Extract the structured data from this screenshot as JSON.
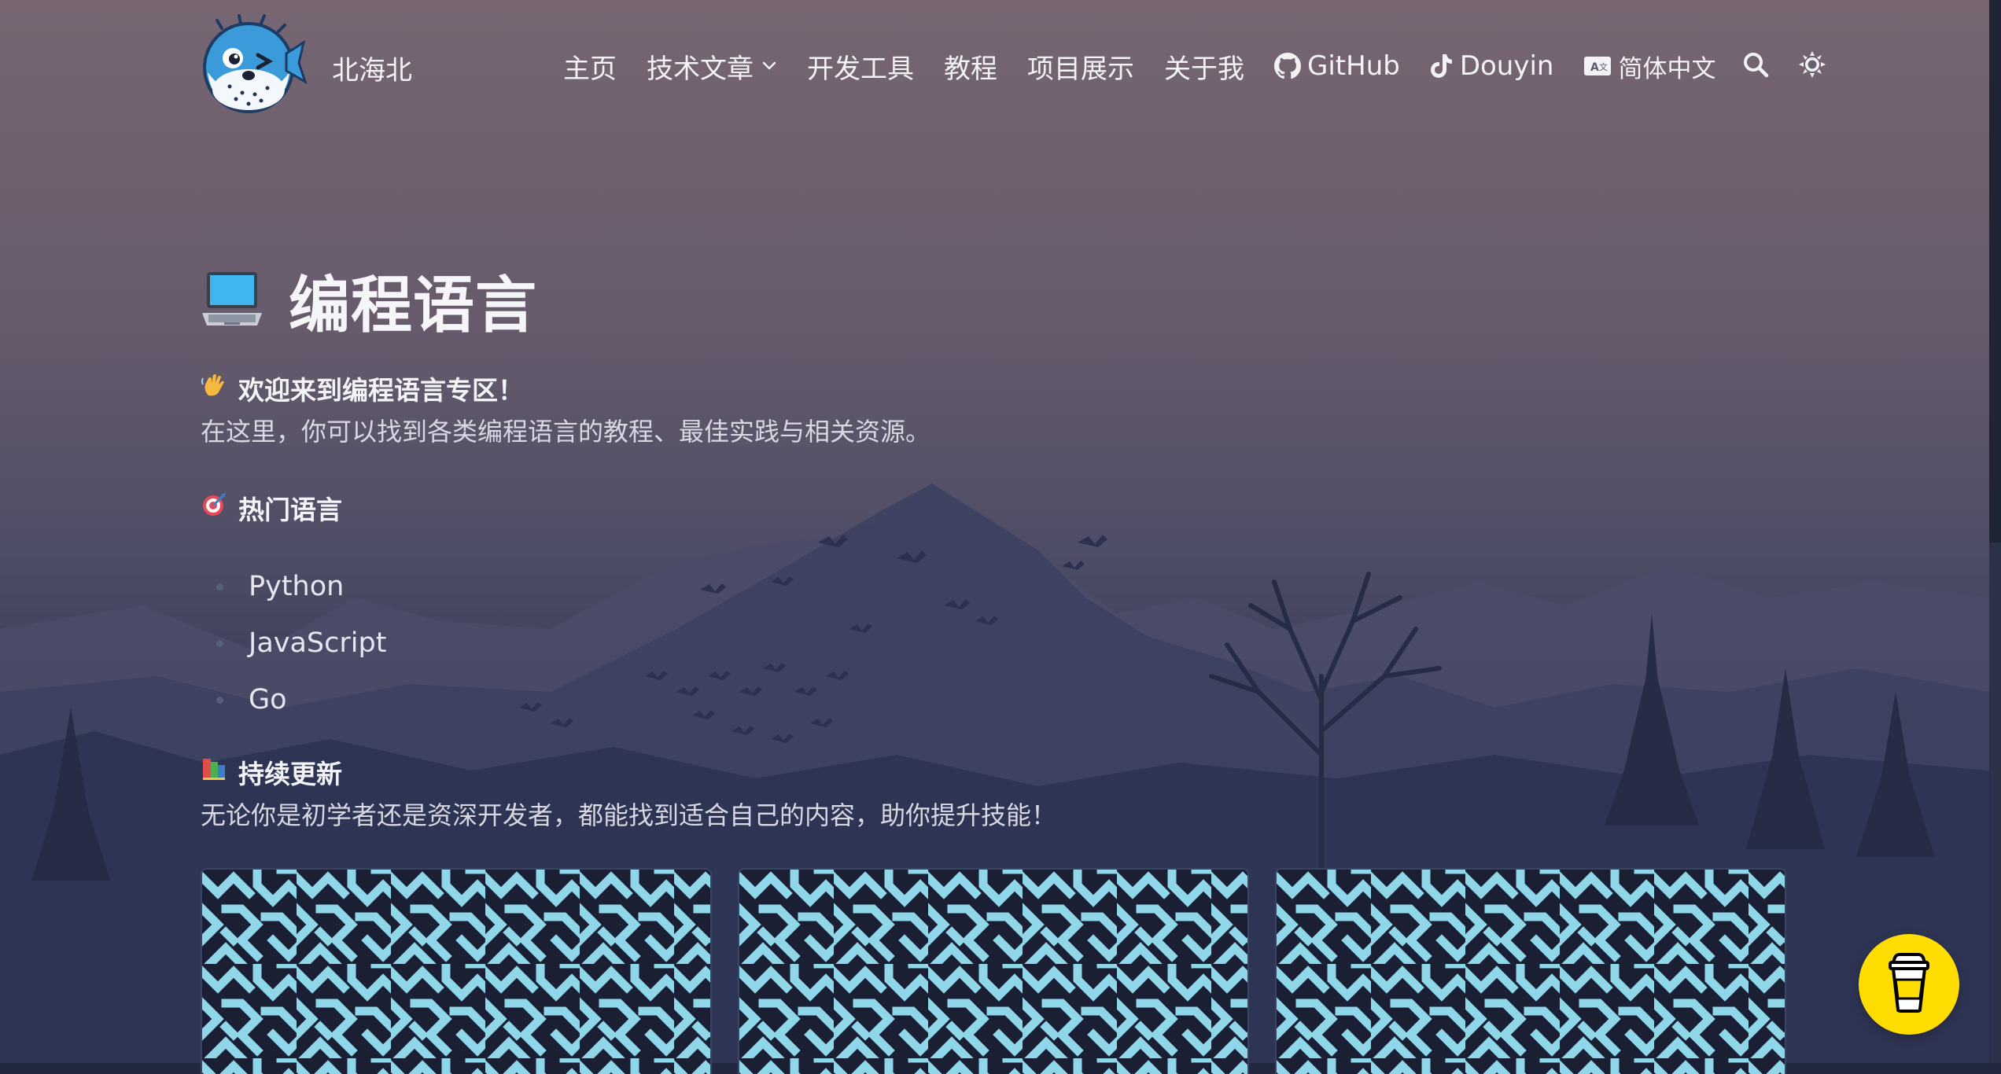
{
  "site": {
    "name": "北海北"
  },
  "nav": {
    "home": "主页",
    "articles": "技术文章",
    "devtools": "开发工具",
    "tutorials": "教程",
    "projects": "项目展示",
    "about": "关于我",
    "github": "GitHub",
    "douyin": "Douyin",
    "language": "简体中文"
  },
  "icons": {
    "articles_dropdown": "chevron-down-icon",
    "github": "github-icon",
    "douyin": "tiktok-icon",
    "language": "translate-icon",
    "search": "search-icon",
    "theme": "sun-icon",
    "coffee": "coffee-cup-icon"
  },
  "page": {
    "title": "编程语言",
    "title_emoji": "laptop-emoji"
  },
  "sections": {
    "welcome": {
      "emoji": "waving-hand-emoji",
      "heading": "欢迎来到编程语言专区！",
      "text": "在这里，你可以找到各类编程语言的教程、最佳实践与相关资源。"
    },
    "popular": {
      "emoji": "direct-hit-emoji",
      "heading": "热门语言",
      "items": [
        "Python",
        "JavaScript",
        "Go"
      ]
    },
    "updates": {
      "emoji": "books-emoji",
      "heading": "持续更新",
      "text": "无论你是初学者还是资深开发者，都能找到适合自己的内容，助你提升技能！"
    }
  },
  "colors": {
    "card_pattern_fg": "#8fd6e8",
    "card_pattern_bg": "#1a1f33",
    "coffee_button": "#ffdd00"
  }
}
